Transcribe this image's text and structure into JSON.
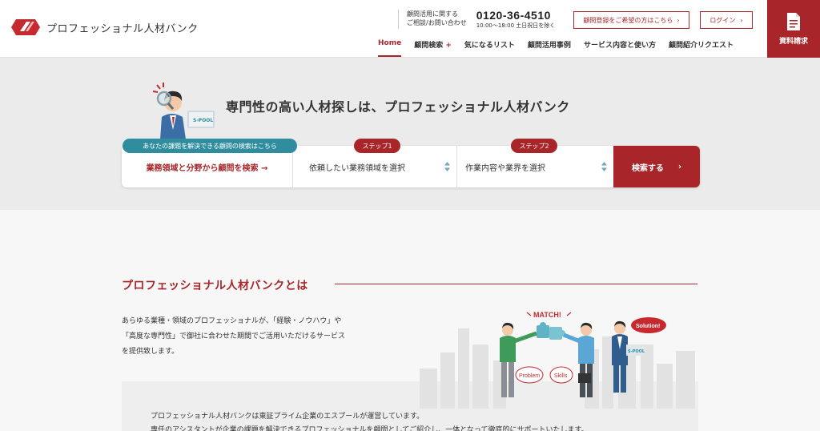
{
  "header": {
    "logo_text": "プロフェッショナル人材バンク",
    "contact": {
      "label_line1": "顧問活用に関する",
      "label_line2": "ご相談/お問い合わせ",
      "phone": "0120-36-4510",
      "hours": "10:00〜18:00 土日祝日を除く"
    },
    "consult_button": "顧問登録をご希望の方はこちら",
    "login_button": "ログイン",
    "doc_request_label": "資料請求",
    "nav": [
      {
        "label": "Home",
        "active": true
      },
      {
        "label": "顧問検索",
        "plus": "+"
      },
      {
        "label": "気になるリスト"
      },
      {
        "label": "顧問活用事例"
      },
      {
        "label": "サービス内容と使い方"
      },
      {
        "label": "顧問紹介リクエスト"
      }
    ]
  },
  "hero": {
    "title": "専門性の高い人材探しは、プロフェッショナル人材バンク",
    "illustration_text": "S-POOL",
    "tag_main": "あなたの課題を解決できる顧問の検索はこちら",
    "tag_step1": "ステップ1",
    "tag_step2": "ステップ2",
    "search_link": "業務領域と分野から顧問を検索 →",
    "select_1": "依頼したい業務領域を選択",
    "select_2": "作業内容や業界を選択",
    "search_button": "検索する",
    "search_button_arrow": "›"
  },
  "about": {
    "title": "プロフェッショナル人材バンクとは",
    "text_lines": [
      "あらゆる業種・領域のプロフェッショナルが、「経験・ノウハウ」や",
      "「高度な専門性」で御社に合わせた期間でご活用いただけるサービス",
      "を提供致します。"
    ],
    "illustration_labels": {
      "match": "MATCH!",
      "solution": "Solution!",
      "problem": "Problem",
      "skills": "Skills",
      "laptop": "S-POOL"
    },
    "company_lines": [
      "プロフェッショナル人材バンクは東証プライム企業のエスプールが運営しています。",
      "専任のアシスタントが企業の課題を解決できるプロフェッショナルを顧問としてご紹介し、一体となって徹底的にサポートいたします。"
    ]
  },
  "colors": {
    "accent": "#a8262a",
    "teal": "#2f8d9e",
    "hero_bg": "#ebebeb"
  }
}
